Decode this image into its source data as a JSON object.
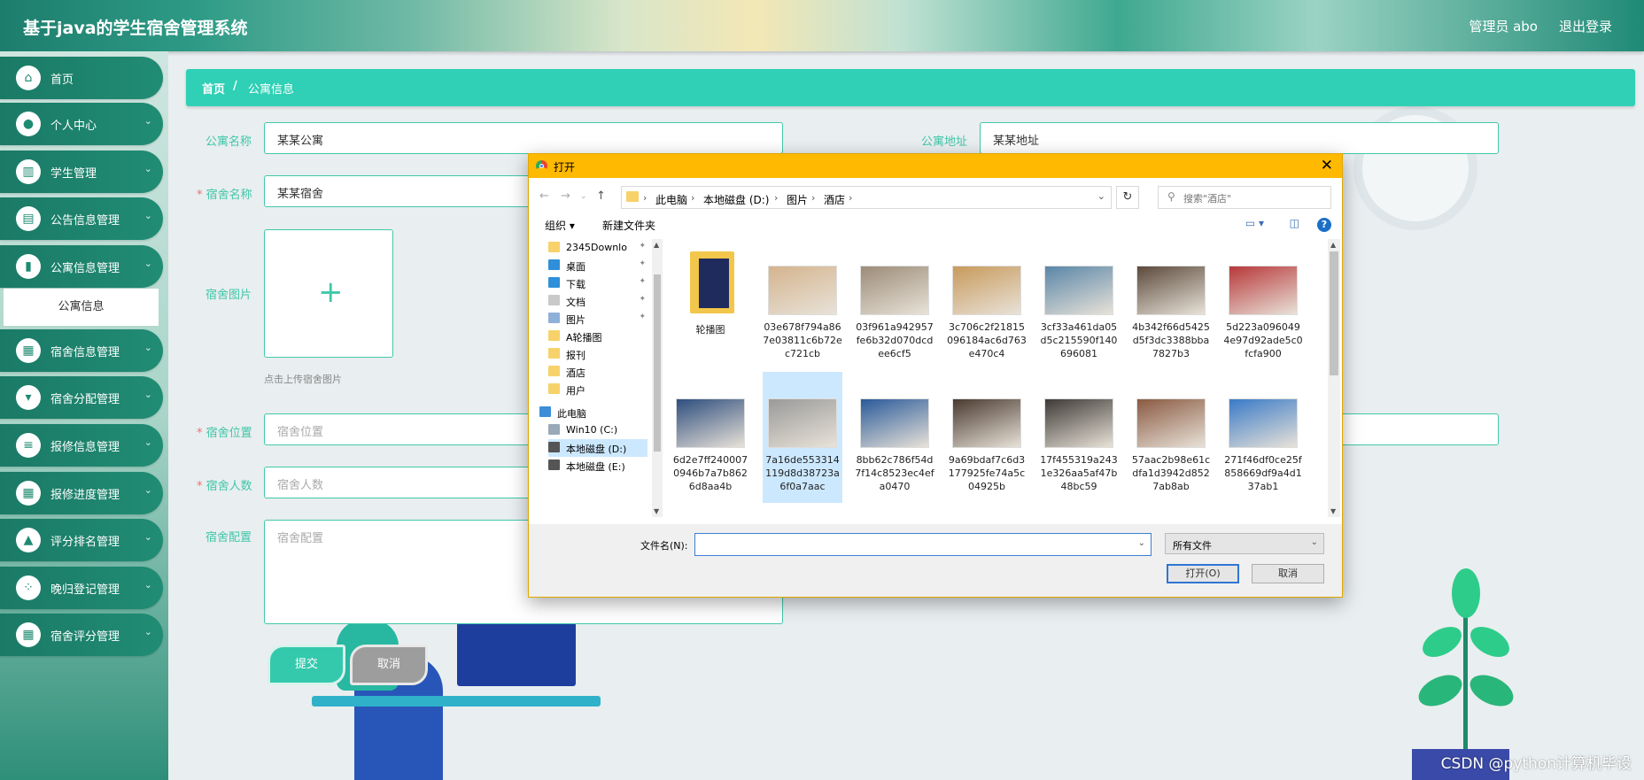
{
  "header": {
    "title": "基于java的学生宿舍管理系统",
    "admin": "管理员 abo",
    "logout": "退出登录"
  },
  "sidebar": {
    "items": [
      {
        "label": "首页",
        "icon": "home-icon",
        "glyph": "⌂"
      },
      {
        "label": "个人中心",
        "icon": "user-icon",
        "glyph": "●"
      },
      {
        "label": "学生管理",
        "icon": "chart-icon",
        "glyph": "▥"
      },
      {
        "label": "公告信息管理",
        "icon": "briefcase-icon",
        "glyph": "▤"
      },
      {
        "label": "公寓信息管理",
        "icon": "book-icon",
        "glyph": "▮"
      },
      {
        "label": "宿舍信息管理",
        "icon": "grid-icon",
        "glyph": "▦"
      },
      {
        "label": "宿舍分配管理",
        "icon": "badge-icon",
        "glyph": "▾"
      },
      {
        "label": "报修信息管理",
        "icon": "sliders-icon",
        "glyph": "≡"
      },
      {
        "label": "报修进度管理",
        "icon": "grid-icon",
        "glyph": "▦"
      },
      {
        "label": "评分排名管理",
        "icon": "thumb-icon",
        "glyph": "▲"
      },
      {
        "label": "晚归登记管理",
        "icon": "dots-grid-icon",
        "glyph": "⁘"
      },
      {
        "label": "宿舍评分管理",
        "icon": "grid-icon",
        "glyph": "▦"
      }
    ],
    "sub_item": "公寓信息"
  },
  "breadcrumb": {
    "home": "首页",
    "sep": "/",
    "current": "公寓信息"
  },
  "form": {
    "apartment_name_label": "公寓名称",
    "apartment_name_value": "某某公寓",
    "apartment_addr_label": "公寓地址",
    "apartment_addr_value": "某某地址",
    "dorm_name_label": "宿舍名称",
    "dorm_name_value": "某某宿舍",
    "dorm_image_label": "宿舍图片",
    "upload_hint": "点击上传宿舍图片",
    "dorm_location_label": "宿舍位置",
    "dorm_location_placeholder": "宿舍位置",
    "dorm_count_label": "宿舍人数",
    "dorm_count_placeholder": "宿舍人数",
    "dorm_config_label": "宿舍配置",
    "dorm_config_placeholder": "宿舍配置",
    "required_mark": "*",
    "submit": "提交",
    "cancel": "取消"
  },
  "dialog": {
    "title": "打开",
    "close": "✕",
    "path": [
      "此电脑",
      "本地磁盘 (D:)",
      "图片",
      "酒店"
    ],
    "search_placeholder": "搜索\"酒店\"",
    "organize": "组织 ▾",
    "new_folder": "新建文件夹",
    "tree": [
      {
        "label": "2345Downlo",
        "color": "#f7d26a",
        "pin": true
      },
      {
        "label": "桌面",
        "color": "#2f8fd8",
        "pin": true
      },
      {
        "label": "下载",
        "color": "#2f8fd8",
        "pin": true
      },
      {
        "label": "文档",
        "color": "#c9c9c9",
        "pin": true
      },
      {
        "label": "图片",
        "color": "#8fb0d8",
        "pin": true
      },
      {
        "label": "A轮播图",
        "color": "#f7d26a",
        "pin": false
      },
      {
        "label": "报刊",
        "color": "#f7d26a",
        "pin": false
      },
      {
        "label": "酒店",
        "color": "#f7d26a",
        "pin": false
      },
      {
        "label": "用户",
        "color": "#f7d26a",
        "pin": false
      },
      {
        "label": "此电脑",
        "color": "#3d8ed8",
        "pin": false
      },
      {
        "label": "Win10 (C:)",
        "color": "#9aa9b8",
        "pin": false
      },
      {
        "label": "本地磁盘 (D:)",
        "color": "#555",
        "pin": false
      },
      {
        "label": "本地磁盘 (E:)",
        "color": "#555",
        "pin": false
      }
    ],
    "folder_name": "轮播图",
    "files": [
      {
        "name": "03e678f794a867e03811c6b72ec721cb",
        "color": "#d4b48e"
      },
      {
        "name": "03f961a942957fe6b32d070dcdee6cf5",
        "color": "#9c8c78"
      },
      {
        "name": "3c706c2f21815096184ac6d763e470c4",
        "color": "#c89a5c"
      },
      {
        "name": "3cf33a461da05d5c215590f140696081",
        "color": "#5a86a8"
      },
      {
        "name": "4b342f66d5425d5f3dc3388bba7827b3",
        "color": "#5c4a3c"
      },
      {
        "name": "5d223a0960494e97d92ade5c0fcfa900",
        "color": "#b8383a"
      },
      {
        "name": "6d2e7ff2400070946b7a7b8626d8aa4b",
        "color": "#2e4e7e"
      },
      {
        "name": "7a16de553314119d8d38723a6f0a7aac",
        "color": "#9a9a9a"
      },
      {
        "name": "8bb62c786f54d7f14c8523ec4efa0470",
        "color": "#2a5a9a"
      },
      {
        "name": "9a69bdaf7c6d3177925fe74a5c04925b",
        "color": "#4a3a30"
      },
      {
        "name": "17f455319a2431e326aa5af47b48bc59",
        "color": "#3e3a36"
      },
      {
        "name": "57aac2b98e61cdfa1d3942d8527ab8ab",
        "color": "#8a5a42"
      },
      {
        "name": "271f46df0ce25f858669df9a4d137ab1",
        "color": "#3a7ac8"
      }
    ],
    "filename_label": "文件名(N):",
    "filter": "所有文件",
    "open": "打开(O)",
    "cancel": "取消"
  },
  "watermark": "CSDN @python计算机毕设"
}
